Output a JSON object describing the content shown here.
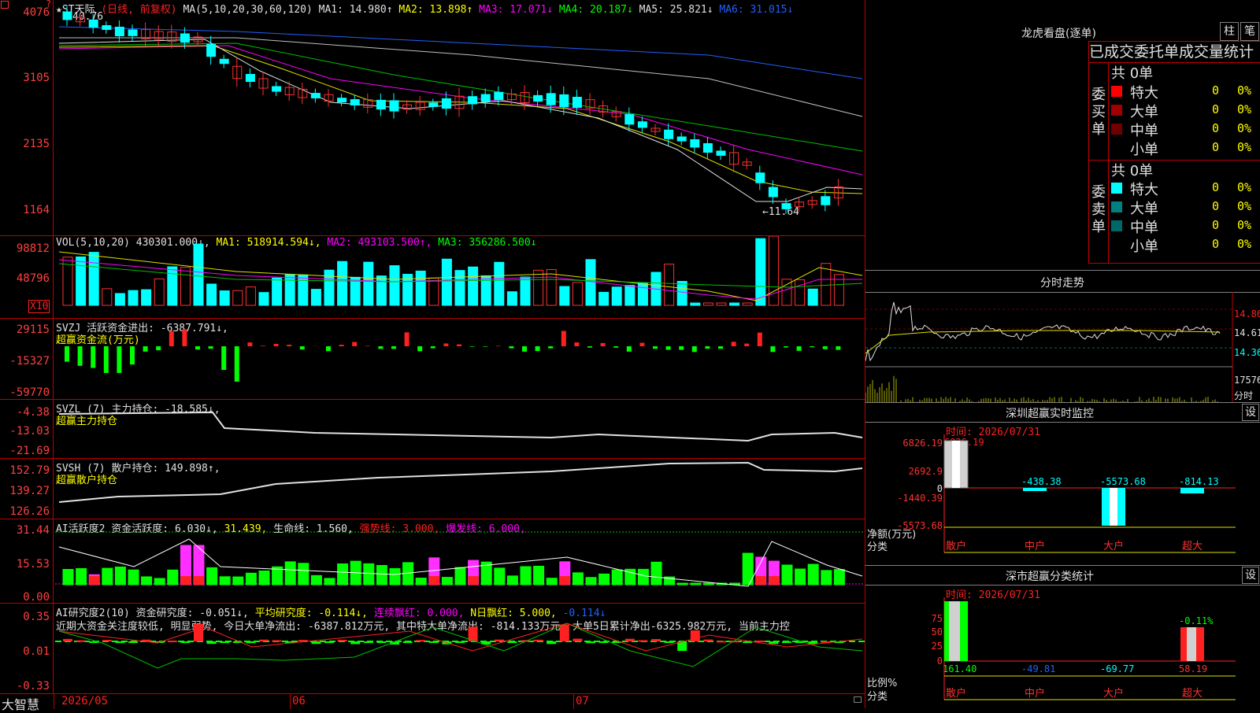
{
  "kline": {
    "header_title": "★ST天际",
    "header_mode": "(日线, 前复权)",
    "header_ma": "MA(5,10,20,30,60,120)",
    "ma1": "MA1: 14.980↑",
    "ma2": "MA2: 13.898↑",
    "ma3": "MA3: 17.071↓",
    "ma4": "MA4: 20.187↓",
    "ma5": "MA5: 25.821↓",
    "ma6": "MA6: 31.015↓",
    "high_label": "40.76",
    "low_label": "←11.64",
    "y_ticks": [
      "4076",
      "3105",
      "2135",
      "1164"
    ]
  },
  "vol": {
    "header": "VOL(5,10,20)",
    "value": "430301.000↓,",
    "ma1": "MA1: 518914.594↓,",
    "ma2": "MA2: 493103.500↑,",
    "ma3": "MA3: 356286.500↓",
    "y_ticks": [
      "98812",
      "48796"
    ],
    "unit": "X10"
  },
  "svzj": {
    "header": "SVZJ  活跃资金进出: -6387.791↓,",
    "sub": "超赢资金流(万元)",
    "y_ticks": [
      "29115",
      "-15327",
      "-59770"
    ]
  },
  "svzl": {
    "header": "SVZL (7) 主力持仓: -18.585↓,",
    "sub": "超赢主力持仓",
    "y_ticks": [
      "-4.38",
      "-13.03",
      "-21.69"
    ]
  },
  "svsh": {
    "header": "SVSH (7) 散户持仓: 149.898↑,",
    "sub": "超赢散户持仓",
    "y_ticks": [
      "152.79",
      "139.27",
      "126.26"
    ]
  },
  "ai2": {
    "h1": "AI活跃度2 资金活跃度: 6.030↓,",
    "h2": "31.439,",
    "h3": "生命线: 1.560,",
    "h4": "强势线: 3.000,",
    "h5": "爆发线: 6.000,",
    "y_ticks": [
      "31.44",
      "15.53",
      "0.00"
    ]
  },
  "ai_research": {
    "h1": "AI研究度2(10) 资金研究度: -0.051↓,",
    "h2": "平均研究度: -0.114↓,",
    "h3": "连续飘红: 0.000,",
    "h4": "N日飘红: 5.000,",
    "h5": "-0.114↓",
    "note": "近期大资金关注度较低, 明显弱势, 今日大单净流出: -6387.812万元, 其中特大单净流出: -814.133万元, 大单5日累计净出-6325.982万元, 当前主力控",
    "y_ticks": [
      "0.35",
      "0.01",
      "-0.33"
    ]
  },
  "bottom_axis": {
    "brand": "大智慧",
    "dates": [
      "2026/05",
      "06",
      "07"
    ]
  },
  "dragon_tiger": {
    "title": "龙虎看盘(逐单)",
    "btn_column": "柱",
    "btn_pen": "笔",
    "subtitle": "已成交委托单成交量统计",
    "buy_label": "委买单",
    "sell_label": "委卖单",
    "buy_total": "共 0单",
    "sell_total": "共 0单",
    "buy_rows": [
      {
        "label": "特大",
        "count": "0",
        "pct": "0%",
        "color": "#ff0000"
      },
      {
        "label": "大单",
        "count": "0",
        "pct": "0%",
        "color": "#a00000"
      },
      {
        "label": "中单",
        "count": "0",
        "pct": "0%",
        "color": "#700000"
      },
      {
        "label": "小单",
        "count": "0",
        "pct": "0%",
        "color": "#000000"
      }
    ],
    "sell_rows": [
      {
        "label": "特大",
        "count": "0",
        "pct": "0%",
        "color": "#00ffff"
      },
      {
        "label": "大单",
        "count": "0",
        "pct": "0%",
        "color": "#008080"
      },
      {
        "label": "中单",
        "count": "0",
        "pct": "0%",
        "color": "#006868"
      },
      {
        "label": "小单",
        "count": "0",
        "pct": "0%",
        "color": "#000000"
      }
    ]
  },
  "intraday": {
    "title": "分时走势",
    "p1": "14.86",
    "p2": "14.61",
    "p3": "14.36",
    "vol": "17576",
    "vol_label": "分时"
  },
  "sz_monitor": {
    "title": "深圳超赢实时监控",
    "btn": "设",
    "time": "时间: 2026/07/31",
    "top_val": "6826.19",
    "y_ticks": [
      "6826.19",
      "2692.9",
      "0",
      "-1440.39",
      "-5573.68"
    ],
    "bar_values": [
      "-438.38",
      "-5573.68",
      "-814.13"
    ],
    "axis_unit": "净额(万元)",
    "axis_cat": "分类",
    "cats": [
      "散户",
      "中户",
      "大户",
      "超大"
    ]
  },
  "sz_classify": {
    "title": "深市超赢分类统计",
    "btn": "设",
    "time": "时间: 2026/07/31",
    "y_ticks": [
      "75",
      "50",
      "25",
      "0"
    ],
    "top_label": "-0.11%",
    "axis_unit": "比例%",
    "axis_cat": "分类",
    "cat_values": [
      "161.40",
      "-49.81",
      "-69.77",
      "58.19"
    ],
    "cats": [
      "散户",
      "中户",
      "大户",
      "超大"
    ]
  }
}
